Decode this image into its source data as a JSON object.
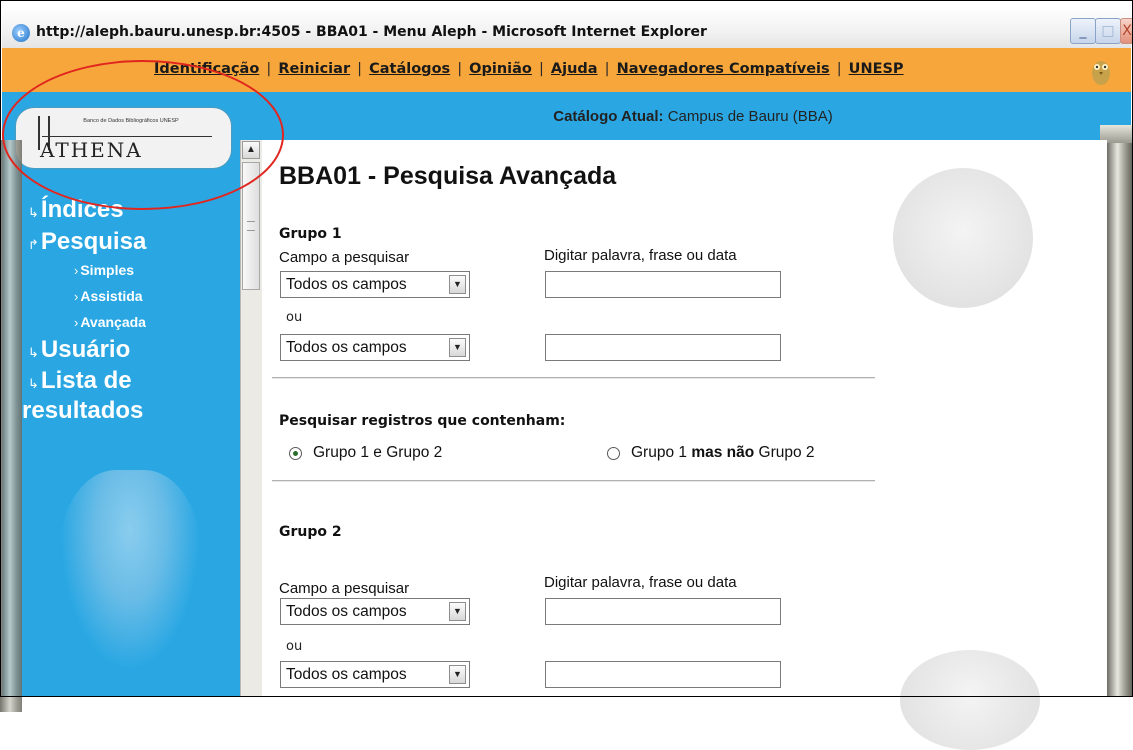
{
  "window": {
    "title": "http://aleph.bauru.unesp.br:4505 - BBA01 - Menu Aleph - Microsoft Internet Explorer",
    "icon": "ie-icon",
    "minimize": "_",
    "maximize": "□",
    "close": "X"
  },
  "topnav": {
    "items": [
      "Identificação",
      "Reiniciar",
      "Catálogos",
      "Opinião",
      "Ajuda",
      "Navegadores Compatíveis",
      "UNESP"
    ],
    "separator": "|"
  },
  "catalog": {
    "label": "Catálogo Atual:",
    "value": "Campus de Bauru (BBA)"
  },
  "logo": {
    "small_text": "Banco de Dados Bibliográficos UNESP",
    "name": "ATHENA"
  },
  "leftnav": {
    "indices": "Índices",
    "pesquisa": "Pesquisa",
    "simples": "Simples",
    "assistida": "Assistida",
    "avancada": "Avançada",
    "usuario": "Usuário",
    "lista_line1": "Lista de",
    "lista_line2": "resultados"
  },
  "page": {
    "title": "BBA01 - Pesquisa Avançada"
  },
  "grupo1": {
    "title": "Grupo 1",
    "campo_label": "Campo a pesquisar",
    "digitar_label": "Digitar palavra, frase ou data",
    "select1": "Todos os campos",
    "ou": "ou",
    "select2": "Todos os campos",
    "input1_value": "",
    "input2_value": ""
  },
  "combine": {
    "title": "Pesquisar registros que contenham:",
    "option1": "Grupo 1 e Grupo 2",
    "option2_a": "Grupo 1",
    "option2_b": "mas não",
    "option2_c": "Grupo 2",
    "selected": "option1"
  },
  "grupo2": {
    "title": "Grupo 2",
    "campo_label": "Campo a pesquisar",
    "digitar_label": "Digitar palavra, frase ou data",
    "select1": "Todos os campos",
    "ou": "ou",
    "select2": "Todos os campos",
    "input1_value": "",
    "input2_value": ""
  },
  "colors": {
    "nav_orange": "#f7a63b",
    "content_blue": "#2aa7e3",
    "annotation_red": "#e0261f"
  }
}
